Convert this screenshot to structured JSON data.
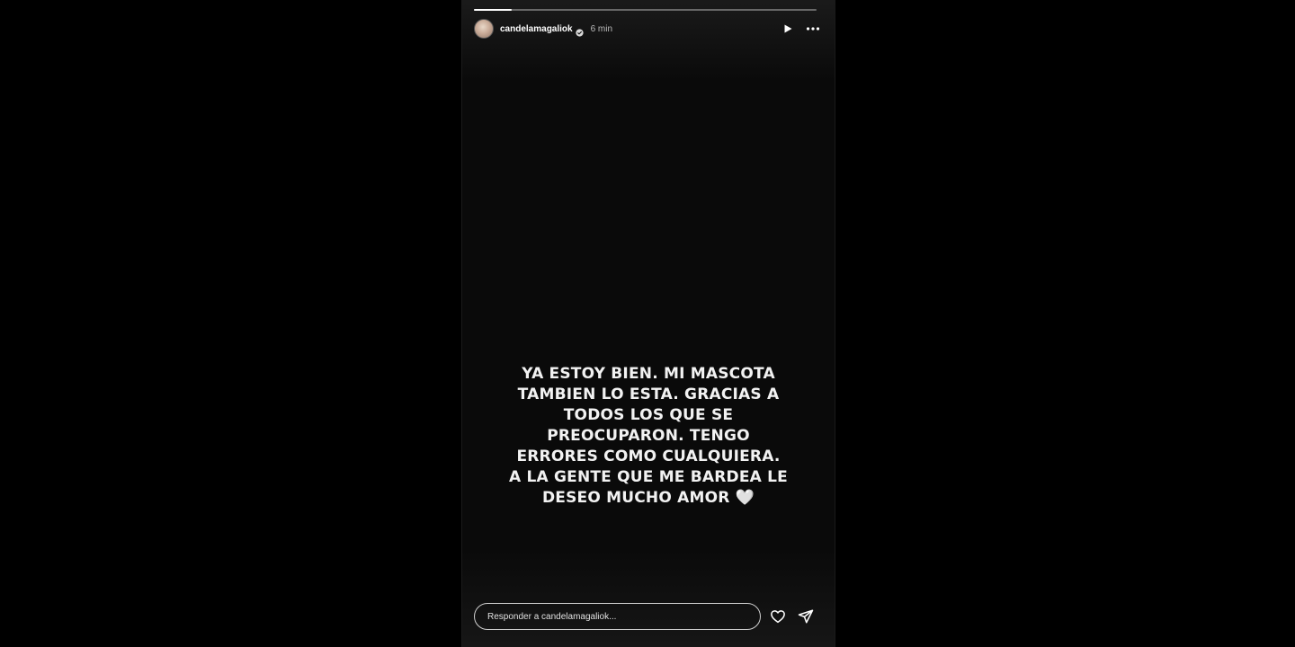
{
  "story": {
    "progress": 0.11,
    "user": {
      "username": "candelamagaliok",
      "verified": true,
      "time": "6 min"
    },
    "message_lines": [
      "YA ESTOY BIEN. MI MASCOTA",
      "TAMBIEN LO ESTA. GRACIAS A",
      "TODOS LOS QUE SE",
      "PREOCUPARON. TENGO",
      "ERRORES COMO CUALQUIERA.",
      "A LA GENTE QUE ME BARDEA LE",
      "DESEO MUCHO AMOR 🤍"
    ]
  },
  "reply": {
    "placeholder": "Responder a candelamagaliok..."
  },
  "icons": {
    "play": "play-icon",
    "more": "more-options-icon",
    "like": "heart-icon",
    "share": "send-icon"
  }
}
